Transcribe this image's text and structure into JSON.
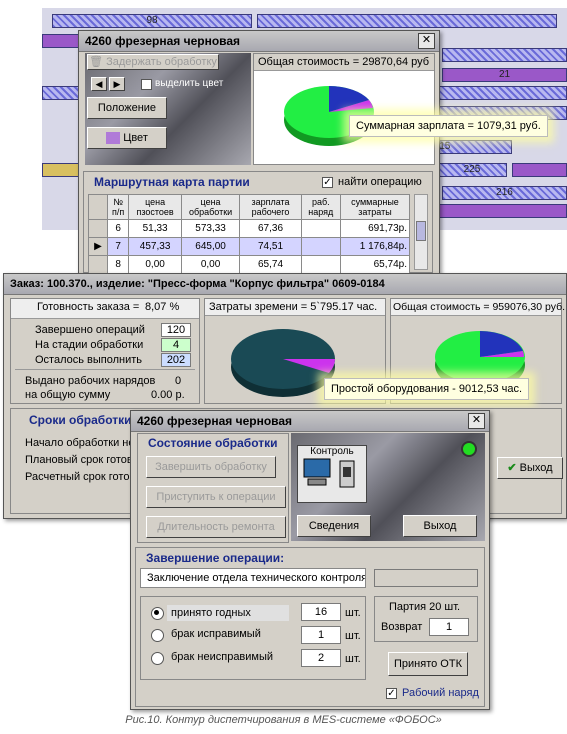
{
  "gantt": {
    "labels": [
      "98",
      "21",
      "215",
      "225",
      "216"
    ]
  },
  "route_window": {
    "title": "4260 фрезерная черновая",
    "hold_button": "Задержать обработку",
    "highlight_color": "выделить цвет",
    "position_button": "Положение",
    "color_button": "Цвет",
    "total_cost": "Общая стоимость = 29870,64 руб",
    "salary_tooltip": "Суммарная зарплата = 1079,31 руб.",
    "route_card_title": "Маршрутная карта партии",
    "find_operation": "найти операцию",
    "table": {
      "headers": [
        "№ п/п",
        "цена пзостоев",
        "цена обработки",
        "зарплата рабочего",
        "раб. наряд",
        "суммарные затраты"
      ],
      "rows": [
        [
          "6",
          "51,33",
          "573,33",
          "67,36",
          "",
          "691,73р."
        ],
        [
          "7",
          "457,33",
          "645,00",
          "74,51",
          "",
          "1 176,84р."
        ],
        [
          "8",
          "0,00",
          "0,00",
          "65,74",
          "",
          "65,74р."
        ]
      ]
    }
  },
  "order_window": {
    "title": "Заказ: 100.370., изделие: \"Пресс-форма \"Корпус фильтра\" 0609-0184",
    "readiness_label": "Готовность заказа =",
    "readiness_value": "8,07 %",
    "completed_label": "Завершено операций",
    "completed_value": "120",
    "in_process_label": "На стадии обработки",
    "in_process_value": "4",
    "remaining_label": "Осталось выполнить",
    "remaining_value": "202",
    "work_orders_label": "Выдано рабочих нарядов",
    "work_orders_value": "0",
    "total_sum_label": "на общую сумму",
    "total_sum_value": "0.00 р.",
    "time_costs": "Затраты зремени = 5`795.17 час.",
    "total_cost": "Общая стоимость = 959076,30 руб.",
    "downtime_tooltip": "Простой оборудования - 9012,53 час.",
    "deadlines_title": "Сроки обработки",
    "start_label": "Начало обработки не",
    "planned_label": "Плановый срок готов",
    "estimated_label": "Расчетный срок готов",
    "exit_button": "Выход"
  },
  "control_window": {
    "title": "4260 фрезерная черновая",
    "state_title": "Состояние обработки",
    "finish_button": "Завершить обработку",
    "start_button": "Приступить к операции",
    "repair_button": "Длительность ремонта",
    "control_label": "Контроль",
    "info_button": "Сведения",
    "exit_button": "Выход",
    "completion_title": "Завершение операции:",
    "qc_tab": "Заключение отдела технического контроля",
    "accepted_label": "принято годных",
    "accepted_value": "16",
    "fixable_label": "брак исправимый",
    "fixable_value": "1",
    "unfixable_label": "брак неисправимый",
    "unfixable_value": "2",
    "unit": "шт.",
    "batch_label": "Партия 20 шт.",
    "return_label": "Возврат",
    "return_value": "1",
    "accepted_qc_button": "Принято ОТК",
    "work_order_checkbox": "Рабочий наряд"
  },
  "caption": "Рис.10. Контур диспетчирования в MES-системе «ФОБОС»",
  "colors": {
    "pie_green": "#22ee44",
    "pie_blue": "#2233bb",
    "pie_violet": "#cc33ee",
    "pie_dark": "#1a4a55",
    "accent_title": "#1a2a8a"
  }
}
